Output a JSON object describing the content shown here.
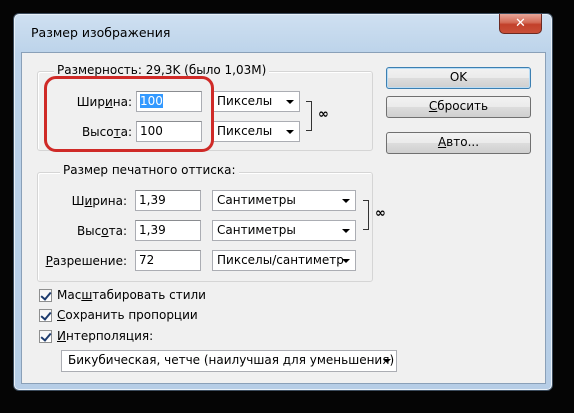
{
  "window": {
    "title": "Размер изображения",
    "close_glyph": "✕"
  },
  "pixel_dimensions": {
    "legend": "Размерность: 29,3K (было 1,03M)",
    "width_label": "Ширина:",
    "width_value": "100",
    "width_unit": "Пикселы",
    "height_label": "Высота:",
    "height_value": "100",
    "height_unit": "Пикселы"
  },
  "document_size": {
    "legend": "Размер печатного оттиска:",
    "width_label": "Ширина:",
    "width_value": "1,39",
    "width_unit": "Сантиметры",
    "height_label": "Высота:",
    "height_value": "1,39",
    "height_unit": "Сантиметры",
    "resolution_label": "Разрешение:",
    "resolution_value": "72",
    "resolution_unit": "Пикселы/сантиметр"
  },
  "buttons": {
    "ok": "OK",
    "reset": "Сбросить",
    "auto": "Авто..."
  },
  "options": {
    "scale_styles": "Масштабировать стили",
    "constrain": "Сохранить пропорции",
    "resample": "Интерполяция:",
    "resample_method": "Бикубическая, четче (наилучшая для уменьшения)"
  },
  "icons": {
    "link": "chain-link-icon",
    "close": "close-icon",
    "dropdown": "chevron-down-icon"
  },
  "colors": {
    "highlight": "#cf2a27",
    "selection": "#3399ff",
    "title_bar": "#bcd3ea"
  }
}
